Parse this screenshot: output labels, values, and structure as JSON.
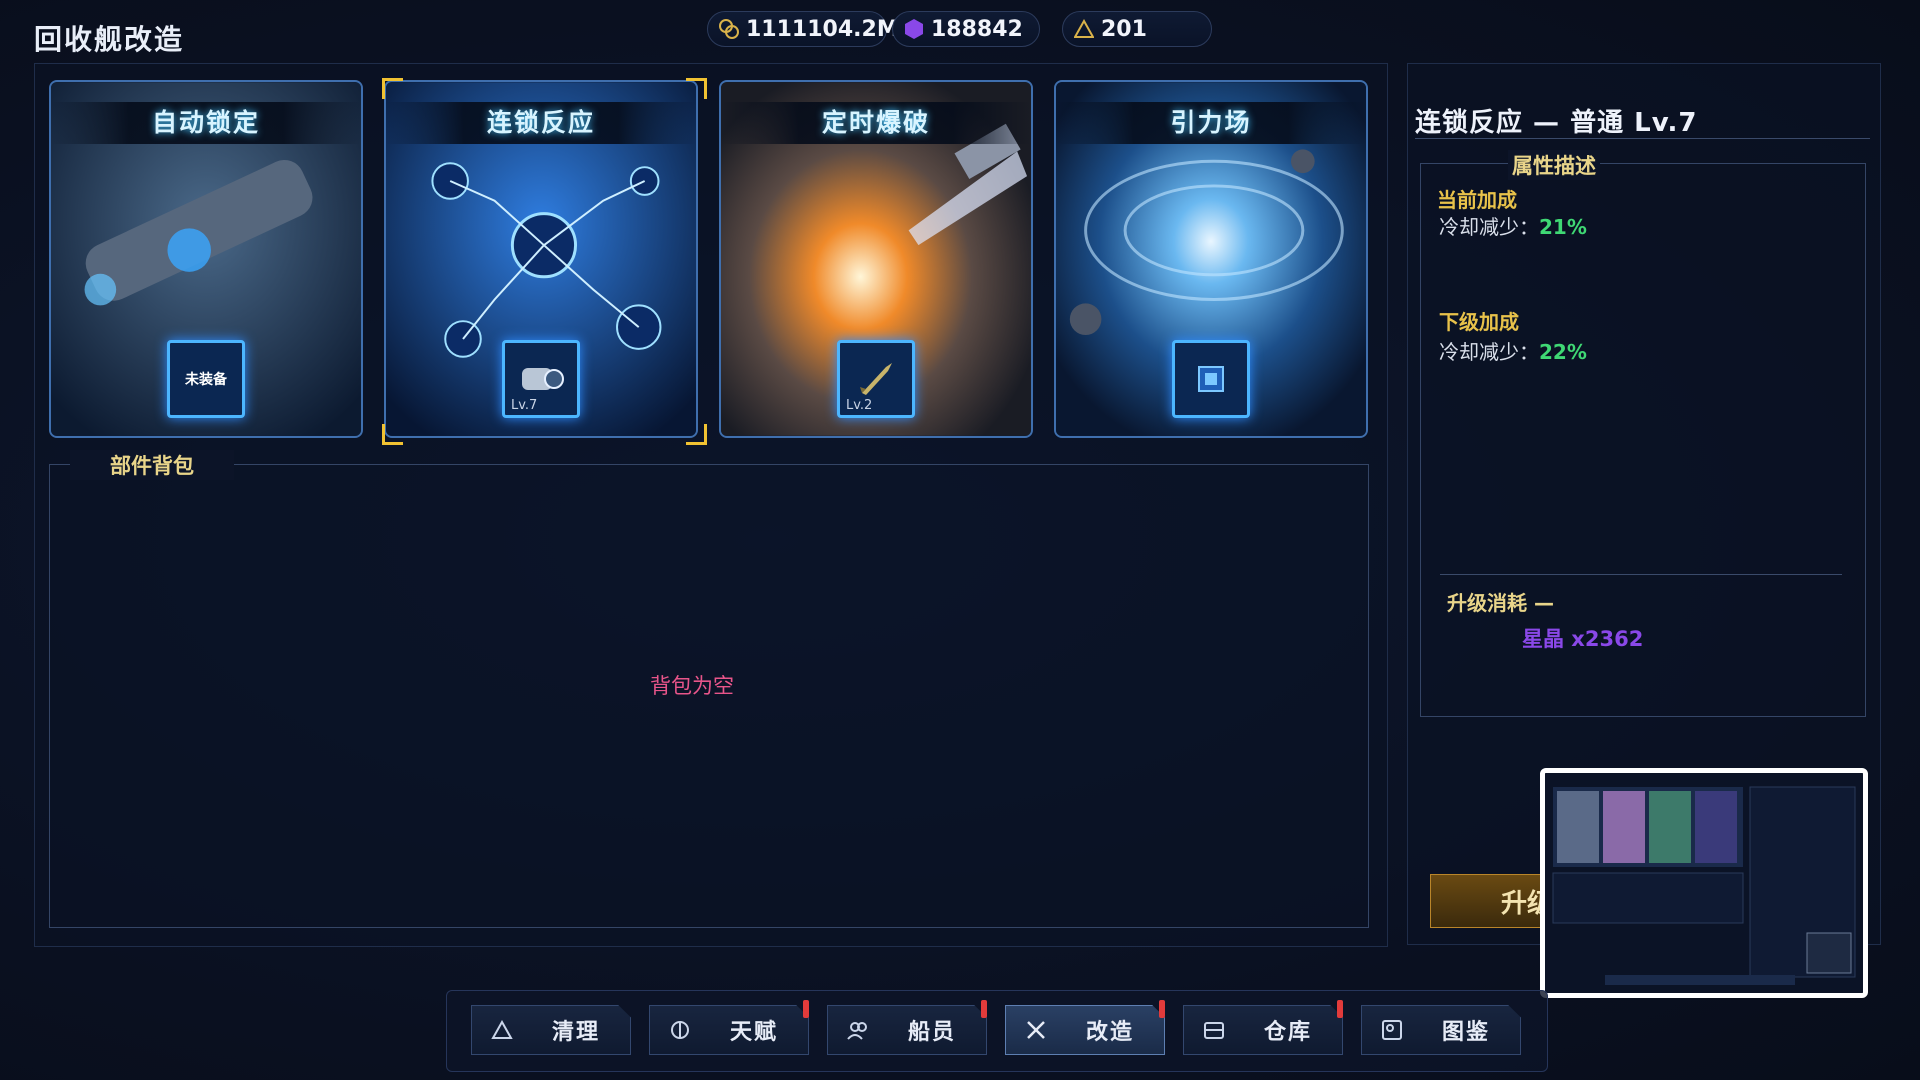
{
  "page": {
    "title": "回收舰改造"
  },
  "resources": [
    {
      "icon": "coin-icon",
      "value": "1111104.2M",
      "color": "#d9b24a"
    },
    {
      "icon": "crystal-icon",
      "value": "188842",
      "color": "#8a48e8"
    },
    {
      "icon": "triangle-icon",
      "value": "201",
      "color": "#d9b24a"
    }
  ],
  "cards": [
    {
      "title": "自动锁定",
      "chip_text": "未装备",
      "level": ""
    },
    {
      "title": "连锁反应",
      "chip_text": "",
      "level": "Lv.7",
      "selected": true
    },
    {
      "title": "定时爆破",
      "chip_text": "",
      "level": "Lv.2"
    },
    {
      "title": "引力场",
      "chip_text": "",
      "level": ""
    }
  ],
  "bag": {
    "title": "部件背包",
    "empty_text": "背包为空"
  },
  "detail": {
    "title": "连锁反应 — 普通 Lv.7",
    "attr_head": "属性描述",
    "current_label": "当前加成",
    "current_stat": "冷却减少：",
    "current_value": "21%",
    "next_label": "下级加成",
    "next_stat": "冷却减少：",
    "next_value": "22%",
    "cost_label": "升级消耗 —",
    "cost_value": "星晶  x2362",
    "upgrade_label": "升级"
  },
  "nav": [
    {
      "label": "清理",
      "icon": "recycle-icon",
      "badge": false
    },
    {
      "label": "天赋",
      "icon": "brain-icon",
      "badge": true
    },
    {
      "label": "船员",
      "icon": "crew-icon",
      "badge": true
    },
    {
      "label": "改造",
      "icon": "tools-icon",
      "badge": true,
      "active": true
    },
    {
      "label": "仓库",
      "icon": "inbox-icon",
      "badge": true
    },
    {
      "label": "图鉴",
      "icon": "gallery-icon",
      "badge": false
    }
  ]
}
